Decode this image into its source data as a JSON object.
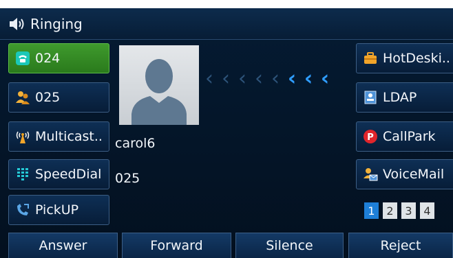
{
  "title": {
    "icon": "speaker-icon",
    "text": "Ringing"
  },
  "left_keys": [
    {
      "icon": "line-phone-icon",
      "label": "024",
      "active": true
    },
    {
      "icon": "contacts-icon",
      "label": "025",
      "active": false
    },
    {
      "icon": "multicast-antenna-icon",
      "label": "Multicast..",
      "active": false
    },
    {
      "icon": "keypad-icon",
      "label": "SpeedDial",
      "active": false
    },
    {
      "icon": "pickup-phone-icon",
      "label": "PickUP",
      "active": false
    }
  ],
  "right_keys": [
    {
      "icon": "briefcase-icon",
      "label": "HotDeski.."
    },
    {
      "icon": "directory-icon",
      "label": "LDAP"
    },
    {
      "icon": "callpark-icon",
      "label": "CallPark"
    },
    {
      "icon": "voicemail-icon",
      "label": "VoiceMail"
    }
  ],
  "caller": {
    "name": "carol6",
    "number": "025"
  },
  "pages": [
    "1",
    "2",
    "3",
    "4"
  ],
  "active_page": "1",
  "softkeys": [
    "Answer",
    "Forward",
    "Silence",
    "Reject"
  ],
  "colors": {
    "accent": "#1e7fd8",
    "active_line": "#3f9a2d",
    "arrow_dim": "#2d5379",
    "arrow_bright": "#2f9dff"
  }
}
